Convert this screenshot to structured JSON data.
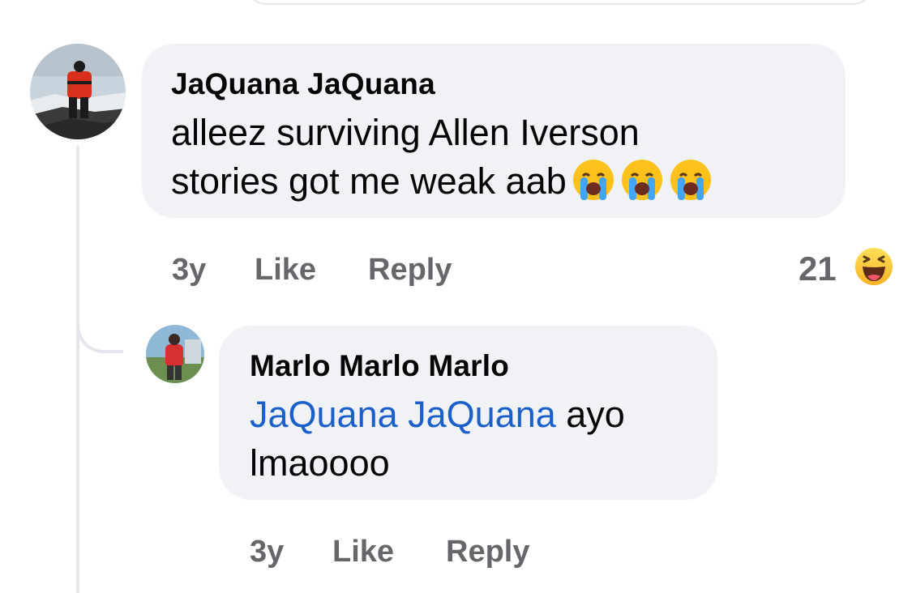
{
  "comments": [
    {
      "author": "JaQuana JaQuana",
      "text_line1": "alleez surviving Allen Iverson",
      "text_line2": "stories got me weak aab",
      "emojis": [
        "loudly-crying-face",
        "loudly-crying-face",
        "loudly-crying-face"
      ],
      "time": "3y",
      "like_label": "Like",
      "reply_label": "Reply",
      "reaction_count": "21",
      "reaction_icon": "haha-reaction"
    }
  ],
  "reply": {
    "author": "Marlo Marlo Marlo",
    "mention": "JaQuana JaQuana",
    "text_after_mention": " ayo",
    "text_line2": "lmaoooo",
    "time": "3y",
    "like_label": "Like",
    "reply_label": "Reply"
  },
  "colors": {
    "bubble": "#f0f2f5",
    "text": "#050505",
    "meta": "#65676b",
    "mention": "#1b5fc9",
    "thread_line": "#e4e6eb"
  }
}
